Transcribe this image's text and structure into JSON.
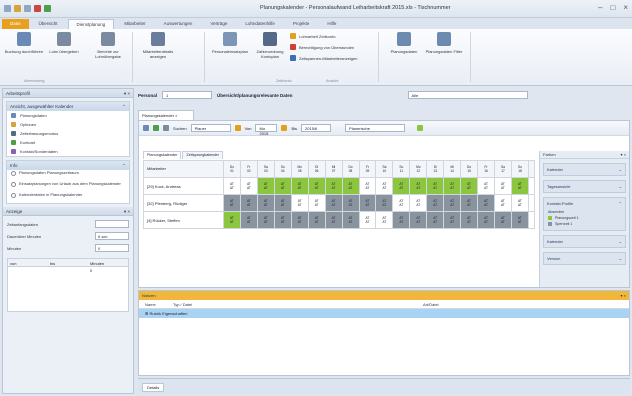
{
  "window": {
    "title": "Planungskalender - Personalaufwand Leiharbeitskraft 2015.xls - Tischnummer"
  },
  "ribbon_tabs": [
    {
      "label": "Datei",
      "active": false,
      "file": true
    },
    {
      "label": "Übersicht",
      "active": false
    },
    {
      "label": "Dienstplanung",
      "active": true
    },
    {
      "label": "Mitarbeiter",
      "active": false
    },
    {
      "label": "Auswertungen",
      "active": false
    },
    {
      "label": "Verträge",
      "active": false
    },
    {
      "label": "Lohndatenhilfe",
      "active": false
    },
    {
      "label": "Projekte",
      "active": false
    },
    {
      "label": "Hilfe",
      "active": false
    }
  ],
  "ribbon": {
    "buttons": [
      {
        "label": "Buchung durchführen",
        "icon": "clock-icon",
        "color": "#6a8ab5"
      },
      {
        "label": "Lohn übergeben",
        "icon": "document-icon",
        "color": "#7a8aa0"
      },
      {
        "label": "Berichte zur Lohnübergabe",
        "icon": "report-icon",
        "color": "#7a8aa0"
      },
      {
        "label": "Mitarbeiterdetails anzeigen",
        "icon": "user-sheet-icon",
        "color": "#6a7e9c"
      },
      {
        "label": "Personaleinsatzplan",
        "icon": "screen-icon",
        "color": "#7d96b8"
      },
      {
        "label": "Zahlenordnung Kontoplan",
        "icon": "gear-icon",
        "color": "#556a88"
      },
      {
        "label": "Planungsdaten",
        "icon": "calendar-icon",
        "color": "#6d8bb0"
      },
      {
        "label": "Planungsdaten Filter",
        "icon": "filter-calendar-icon",
        "color": "#6d8bb0"
      }
    ],
    "small_items": [
      {
        "label": "Lohnarbeit Zeitkonto",
        "color": "#e0a21c"
      },
      {
        "label": "Berechtigung von Überstunden",
        "color": "#d04030"
      },
      {
        "label": "Zeitspannen-Mitarbeiteranzeigen",
        "color": "#3a6fb5"
      }
    ],
    "groups": [
      "Abrechnung",
      "Zeitkonto",
      "Ansicht"
    ]
  },
  "left_panel": {
    "title": "Arbeitsprofil",
    "section1_title": "Ansicht, ausgewählter Kalender",
    "section1_items": [
      {
        "label": "Planungsdaten",
        "color": "#6a8ab5"
      },
      {
        "label": "Optionen",
        "color": "#d7a33b"
      },
      {
        "label": "Zeiterfassungsmodus",
        "color": "#556a88"
      },
      {
        "label": "Kontoart",
        "color": "#4d9f4d"
      },
      {
        "label": "Kontakt/Sonderdaten",
        "color": "#8a5fb5"
      }
    ],
    "section2_title": "Info",
    "section2_options": [
      "Planungsdaten Planungszeitraum",
      "Einsatzplanungen von Urlaub aus dem Planungskalender",
      "Kalenderdaten in Planungskalender"
    ],
    "section3_title": "Anzeige",
    "fields": [
      {
        "label": "Zeitanfangsdaten",
        "value": ""
      },
      {
        "label": "Dauerüber Minuten",
        "value": "6 sec"
      },
      {
        "label": "Minuten",
        "value": "0"
      }
    ],
    "mini_table": {
      "columns": [
        "von",
        "bis",
        "Minuten"
      ],
      "rows": [
        [
          "",
          "",
          "0"
        ]
      ]
    }
  },
  "filterbar": {
    "label": "Personal",
    "value": "1",
    "second_label": "Übersicht/planungsrelevante Daten",
    "dropdown": "Alle"
  },
  "doc_tab": "Planungskalender",
  "toolbar2": {
    "search_label": "Suchen",
    "search_value": "Planer",
    "from_label": "Von",
    "from_value": "Mo 2015",
    "to_label": "Bis",
    "to_value": "2015/6",
    "filter_value": "Planerische"
  },
  "subtabs": [
    "Planungskalender",
    "Zeitsprungkalender"
  ],
  "schedule": {
    "name_header": "Mitarbeiter",
    "days": [
      {
        "wd": "Do",
        "d": "01"
      },
      {
        "wd": "Fr",
        "d": "02"
      },
      {
        "wd": "Sa",
        "d": "03"
      },
      {
        "wd": "So",
        "d": "04"
      },
      {
        "wd": "Mo",
        "d": "05"
      },
      {
        "wd": "Di",
        "d": "06"
      },
      {
        "wd": "Mi",
        "d": "07"
      },
      {
        "wd": "Do",
        "d": "08"
      },
      {
        "wd": "Fr",
        "d": "09"
      },
      {
        "wd": "Sa",
        "d": "10"
      },
      {
        "wd": "So",
        "d": "11"
      },
      {
        "wd": "Mo",
        "d": "12"
      },
      {
        "wd": "Di",
        "d": "13"
      },
      {
        "wd": "Mi",
        "d": "14"
      },
      {
        "wd": "Do",
        "d": "15"
      },
      {
        "wd": "Fr",
        "d": "16"
      },
      {
        "wd": "Sa",
        "d": "17"
      },
      {
        "wd": "So",
        "d": "18"
      }
    ],
    "rows": [
      {
        "name": "[29] Kock, Andreas",
        "cells": [
          "w",
          "w",
          "g",
          "g",
          "g",
          "g",
          "g",
          "g",
          "w",
          "w",
          "g",
          "g",
          "g",
          "g",
          "g",
          "w",
          "w",
          "g"
        ]
      },
      {
        "name": "[32] Pfenberg, Rüdiger",
        "cells": [
          "d",
          "d",
          "d",
          "d",
          "w",
          "w",
          "d",
          "d",
          "d",
          "d",
          "w",
          "w",
          "d",
          "d",
          "d",
          "d",
          "w",
          "w"
        ]
      },
      {
        "name": "[4] Rücker, Steffen",
        "cells": [
          "g",
          "d",
          "d",
          "d",
          "d",
          "d",
          "d",
          "d",
          "w",
          "w",
          "d",
          "d",
          "d",
          "d",
          "d",
          "d",
          "d",
          "d"
        ]
      }
    ],
    "cell_text": "AT"
  },
  "right_panel": {
    "title": "Farben",
    "sections": [
      {
        "label": "Kalender",
        "expanded": false
      },
      {
        "label": "Tagesansicht",
        "expanded": false
      },
      {
        "label": "Kontakt-Profile",
        "expanded": true,
        "items": [
          {
            "label": "Absenden",
            "color": ""
          },
          {
            "label": "Planungszeit 1",
            "color": "#8cc63e"
          },
          {
            "label": "Sperrzeit 1",
            "color": "#8a949e"
          }
        ]
      },
      {
        "label": "Kalender",
        "expanded": false
      },
      {
        "label": "Version",
        "expanded": false
      }
    ]
  },
  "bottom": {
    "title": "Notizen",
    "columns": [
      "Name",
      "Typ / Datei",
      "Art/Datei"
    ],
    "row": "Rubrik Eigenschaften"
  },
  "status": {
    "label": "Details"
  }
}
